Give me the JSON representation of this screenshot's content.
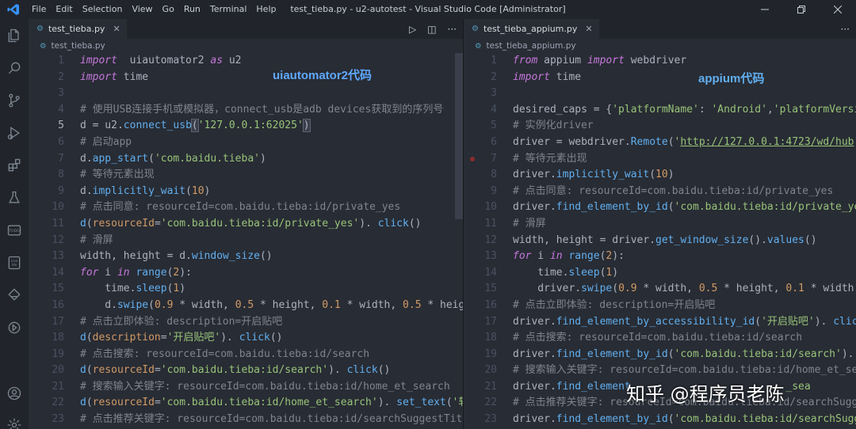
{
  "window": {
    "title": "test_tieba.py - u2-autotest - Visual Studio Code [Administrator]",
    "menu": [
      "File",
      "Edit",
      "Selection",
      "View",
      "Go",
      "Run",
      "Terminal",
      "Help"
    ]
  },
  "activity_icons": [
    "explorer-icon",
    "search-icon",
    "source-control-icon",
    "run-debug-icon",
    "extensions-icon",
    "testing-icon",
    "todo-icon",
    "live-ide-icon",
    "remote-icon",
    "timeline-icon",
    "account-icon",
    "settings-icon"
  ],
  "activity_labels": {
    "todo": "TODO",
    "live": "Live\nIde"
  },
  "left": {
    "tab": "test_tieba.py",
    "breadcrumb": "test_tieba.py",
    "overlay": "uiautomator2代码",
    "lines": [
      {
        "n": "1",
        "segs": [
          [
            "kw",
            "import"
          ],
          [
            "",
            "  uiautomator2 "
          ],
          [
            "kw",
            "as"
          ],
          [
            "",
            " u2"
          ]
        ]
      },
      {
        "n": "2",
        "segs": [
          [
            "kw",
            "import"
          ],
          [
            "",
            " time"
          ]
        ]
      },
      {
        "n": "3",
        "segs": []
      },
      {
        "n": "4",
        "segs": [
          [
            "cm",
            "# 使用USB连接手机或模拟器，connect_usb是adb devices获取到的序列号"
          ]
        ]
      },
      {
        "n": "5",
        "segs": [
          [
            "",
            "d = u2."
          ],
          [
            "fn",
            "connect_usb"
          ],
          [
            "hl",
            "("
          ],
          [
            "st",
            "'127.0.0.1:62025'"
          ],
          [
            "hl",
            ")"
          ]
        ]
      },
      {
        "n": "6",
        "segs": [
          [
            "cm",
            "# 启动app"
          ]
        ]
      },
      {
        "n": "7",
        "segs": [
          [
            "",
            "d."
          ],
          [
            "fn",
            "app_start"
          ],
          [
            "",
            "("
          ],
          [
            "st",
            "'com.baidu.tieba'"
          ],
          [
            "",
            ")"
          ]
        ]
      },
      {
        "n": "8",
        "segs": [
          [
            "cm",
            "# 等待元素出现"
          ]
        ]
      },
      {
        "n": "9",
        "segs": [
          [
            "",
            "d."
          ],
          [
            "fn",
            "implicitly_wait"
          ],
          [
            "",
            "("
          ],
          [
            "nm",
            "10"
          ],
          [
            "",
            ")"
          ]
        ]
      },
      {
        "n": "10",
        "segs": [
          [
            "cm",
            "# 点击同意: resourceId=com.baidu.tieba:id/private_yes"
          ]
        ]
      },
      {
        "n": "11",
        "segs": [
          [
            "fn",
            "d"
          ],
          [
            "",
            "("
          ],
          [
            "nm",
            "resourceId"
          ],
          [
            "",
            "="
          ],
          [
            "st",
            "'com.baidu.tieba:id/private_yes'"
          ],
          [
            "",
            "). "
          ],
          [
            "fn",
            "click"
          ],
          [
            "",
            "()"
          ]
        ]
      },
      {
        "n": "12",
        "segs": [
          [
            "cm",
            "# 滑屏"
          ]
        ]
      },
      {
        "n": "13",
        "segs": [
          [
            "",
            "width, height = d."
          ],
          [
            "fn",
            "window_size"
          ],
          [
            "",
            "()"
          ]
        ]
      },
      {
        "n": "14",
        "segs": [
          [
            "kw",
            "for"
          ],
          [
            "",
            " i "
          ],
          [
            "kw",
            "in"
          ],
          [
            "",
            " "
          ],
          [
            "fn",
            "range"
          ],
          [
            "",
            "("
          ],
          [
            "nm",
            "2"
          ],
          [
            "",
            "):"
          ]
        ]
      },
      {
        "n": "15",
        "segs": [
          [
            "",
            "    time."
          ],
          [
            "fn",
            "sleep"
          ],
          [
            "",
            "("
          ],
          [
            "nm",
            "1"
          ],
          [
            "",
            ")"
          ]
        ]
      },
      {
        "n": "16",
        "segs": [
          [
            "",
            "    d."
          ],
          [
            "fn",
            "swipe"
          ],
          [
            "",
            "("
          ],
          [
            "nm",
            "0.9"
          ],
          [
            "",
            " * width, "
          ],
          [
            "nm",
            "0.5"
          ],
          [
            "",
            " * height, "
          ],
          [
            "nm",
            "0.1"
          ],
          [
            "",
            " * width, "
          ],
          [
            "nm",
            "0.5"
          ],
          [
            "",
            " * height"
          ]
        ]
      },
      {
        "n": "17",
        "segs": [
          [
            "cm",
            "# 点击立即体验: description=开启贴吧"
          ]
        ]
      },
      {
        "n": "18",
        "segs": [
          [
            "fn",
            "d"
          ],
          [
            "",
            "("
          ],
          [
            "nm",
            "description"
          ],
          [
            "",
            "="
          ],
          [
            "st",
            "'开启贴吧'"
          ],
          [
            "",
            "). "
          ],
          [
            "fn",
            "click"
          ],
          [
            "",
            "()"
          ]
        ]
      },
      {
        "n": "19",
        "segs": [
          [
            "cm",
            "# 点击搜索: resourceId=com.baidu.tieba:id/search"
          ]
        ]
      },
      {
        "n": "20",
        "segs": [
          [
            "fn",
            "d"
          ],
          [
            "",
            "("
          ],
          [
            "nm",
            "resourceId"
          ],
          [
            "",
            "="
          ],
          [
            "st",
            "'com.baidu.tieba:id/search'"
          ],
          [
            "",
            "). "
          ],
          [
            "fn",
            "click"
          ],
          [
            "",
            "()"
          ]
        ]
      },
      {
        "n": "21",
        "segs": [
          [
            "cm",
            "# 搜索输入关键字: resourceId=com.baidu.tieba:id/home_et_search"
          ]
        ]
      },
      {
        "n": "22",
        "segs": [
          [
            "fn",
            "d"
          ],
          [
            "",
            "("
          ],
          [
            "nm",
            "resourceId"
          ],
          [
            "",
            "="
          ],
          [
            "st",
            "'com.baidu.tieba:id/home_et_search'"
          ],
          [
            "",
            "). "
          ],
          [
            "fn",
            "set_text"
          ],
          [
            "",
            "("
          ],
          [
            "st",
            "'软件"
          ]
        ]
      },
      {
        "n": "23",
        "segs": [
          [
            "cm",
            "# 点击推荐关键字: resourceId=com.baidu.tieba:id/searchSuggestTitle"
          ]
        ]
      }
    ]
  },
  "right": {
    "tab": "test_tieba_appium.py",
    "breadcrumb": "test_tieba_appium.py",
    "overlay": "appium代码",
    "lines": [
      {
        "n": "1",
        "segs": [
          [
            "kw",
            "from"
          ],
          [
            "",
            " appium "
          ],
          [
            "kw",
            "import"
          ],
          [
            "",
            " webdriver"
          ]
        ]
      },
      {
        "n": "2",
        "segs": [
          [
            "kw",
            "import"
          ],
          [
            "",
            " time"
          ]
        ]
      },
      {
        "n": "3",
        "segs": []
      },
      {
        "n": "4",
        "segs": [
          [
            "",
            "desired_caps = {"
          ],
          [
            "st",
            "'platformName'"
          ],
          [
            "",
            ": "
          ],
          [
            "st",
            "'Android'"
          ],
          [
            "",
            ","
          ],
          [
            "st",
            "'platformVersio"
          ]
        ]
      },
      {
        "n": "5",
        "segs": [
          [
            "cm",
            "# 实例化driver"
          ]
        ]
      },
      {
        "n": "6",
        "segs": [
          [
            "",
            "driver = webdriver."
          ],
          [
            "fn",
            "Remote"
          ],
          [
            "",
            "("
          ],
          [
            "st",
            "'"
          ],
          [
            "url",
            "http://127.0.0.1:4723/wd/hub"
          ],
          [
            "st",
            "'"
          ],
          [
            "",
            ","
          ]
        ]
      },
      {
        "n": "7",
        "segs": [
          [
            "cm",
            "# 等待元素出现"
          ]
        ]
      },
      {
        "n": "8",
        "segs": [
          [
            "",
            "driver."
          ],
          [
            "fn",
            "implicitly_wait"
          ],
          [
            "",
            "("
          ],
          [
            "nm",
            "10"
          ],
          [
            "",
            ")"
          ]
        ]
      },
      {
        "n": "9",
        "segs": [
          [
            "cm",
            "# 点击同意: resourceId=com.baidu.tieba:id/private_yes"
          ]
        ]
      },
      {
        "n": "10",
        "segs": [
          [
            "",
            "driver."
          ],
          [
            "fn",
            "find_element_by_id"
          ],
          [
            "",
            "("
          ],
          [
            "st",
            "'com.baidu.tieba:id/private_yes"
          ]
        ]
      },
      {
        "n": "11",
        "segs": [
          [
            "cm",
            "# 滑屏"
          ]
        ]
      },
      {
        "n": "12",
        "segs": [
          [
            "",
            "width, height = driver."
          ],
          [
            "fn",
            "get_window_size"
          ],
          [
            "",
            "()."
          ],
          [
            "fn",
            "values"
          ],
          [
            "",
            "()"
          ]
        ]
      },
      {
        "n": "13",
        "segs": [
          [
            "kw",
            "for"
          ],
          [
            "",
            " i "
          ],
          [
            "kw",
            "in"
          ],
          [
            "",
            " "
          ],
          [
            "fn",
            "range"
          ],
          [
            "",
            "("
          ],
          [
            "nm",
            "2"
          ],
          [
            "",
            "):"
          ]
        ]
      },
      {
        "n": "14",
        "segs": [
          [
            "",
            "    time."
          ],
          [
            "fn",
            "sleep"
          ],
          [
            "",
            "("
          ],
          [
            "nm",
            "1"
          ],
          [
            "",
            ")"
          ]
        ]
      },
      {
        "n": "15",
        "segs": [
          [
            "",
            "    driver."
          ],
          [
            "fn",
            "swipe"
          ],
          [
            "",
            "("
          ],
          [
            "nm",
            "0.9"
          ],
          [
            "",
            " * width, "
          ],
          [
            "nm",
            "0.5"
          ],
          [
            "",
            " * height, "
          ],
          [
            "nm",
            "0.1"
          ],
          [
            "",
            " * width, "
          ]
        ]
      },
      {
        "n": "16",
        "segs": [
          [
            "cm",
            "# 点击立即体验: description=开启贴吧"
          ]
        ]
      },
      {
        "n": "17",
        "segs": [
          [
            "",
            "driver."
          ],
          [
            "fn",
            "find_element_by_accessibility_id"
          ],
          [
            "",
            "("
          ],
          [
            "st",
            "'开启贴吧'"
          ],
          [
            "",
            "). "
          ],
          [
            "fn",
            "click"
          ],
          [
            "",
            "()"
          ]
        ]
      },
      {
        "n": "18",
        "segs": [
          [
            "cm",
            "# 点击搜索: resourceId=com.baidu.tieba:id/search"
          ]
        ]
      },
      {
        "n": "19",
        "segs": [
          [
            "",
            "driver."
          ],
          [
            "fn",
            "find_element_by_id"
          ],
          [
            "",
            "("
          ],
          [
            "st",
            "'com.baidu.tieba:id/search'"
          ],
          [
            "",
            "). "
          ],
          [
            "fn",
            "cl"
          ]
        ]
      },
      {
        "n": "20",
        "segs": [
          [
            "cm",
            "# 搜索输入关键字: resourceId=com.baidu.tieba:id/home_et_sear"
          ]
        ]
      },
      {
        "n": "21",
        "segs": [
          [
            "",
            "driver."
          ],
          [
            "fn",
            "find_element"
          ],
          [
            "",
            "                         "
          ],
          [
            "st",
            "_sea"
          ]
        ]
      },
      {
        "n": "22",
        "segs": [
          [
            "cm",
            "# 点击推荐关键字: resourceId=com.baidu.tieba:id/searchSugge"
          ]
        ]
      },
      {
        "n": "23",
        "segs": [
          [
            "",
            "driver."
          ],
          [
            "fn",
            "find_element_by_id"
          ],
          [
            "",
            "("
          ],
          [
            "st",
            "'com.baidu.tieba:id/searchSugge"
          ]
        ]
      }
    ]
  },
  "watermark": "知乎 @程序员老陈"
}
